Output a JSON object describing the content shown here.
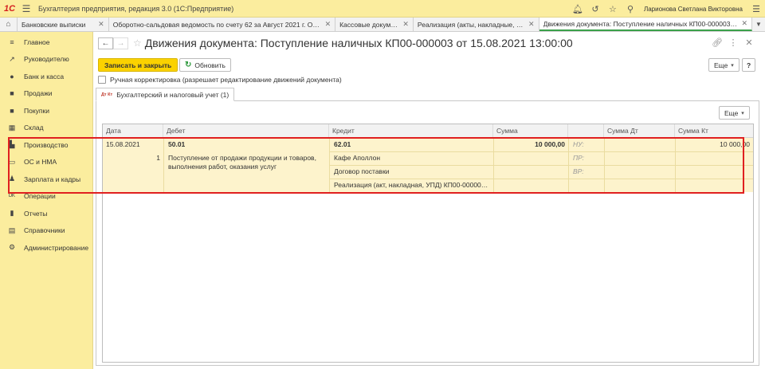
{
  "app": {
    "logo": "1С",
    "title": "Бухгалтерия предприятия, редакция 3.0  (1С:Предприятие)",
    "user": "Ларионова Светлана Викторовна"
  },
  "tabs": [
    {
      "label": "Банковские выписки"
    },
    {
      "label": "Оборотно-сальдовая ведомость по счету 62 за Август 2021 г. ООО \"..."
    },
    {
      "label": "Кассовые документы"
    },
    {
      "label": "Реализация (акты, накладные, УПД)"
    },
    {
      "label": "Движения документа: Поступление наличных КП00-000003 от 15.08...."
    }
  ],
  "sidebar": {
    "items": [
      {
        "label": "Главное",
        "icon": "≡"
      },
      {
        "label": "Руководителю",
        "icon": "↗"
      },
      {
        "label": "Банк и касса",
        "icon": "●"
      },
      {
        "label": "Продажи",
        "icon": "■"
      },
      {
        "label": "Покупки",
        "icon": "■"
      },
      {
        "label": "Склад",
        "icon": "▦"
      },
      {
        "label": "Производство",
        "icon": "▙"
      },
      {
        "label": "ОС и НМА",
        "icon": "▭"
      },
      {
        "label": "Зарплата и кадры",
        "icon": "♟"
      },
      {
        "label": "Операции",
        "icon": "ᴰᴷ"
      },
      {
        "label": "Отчеты",
        "icon": "▮"
      },
      {
        "label": "Справочники",
        "icon": "▤"
      },
      {
        "label": "Администрирование",
        "icon": "⚙"
      }
    ]
  },
  "document": {
    "title": "Движения документа: Поступление наличных КП00-000003 от 15.08.2021 13:00:00",
    "save_close": "Записать и закрыть",
    "refresh": "Обновить",
    "more": "Еще",
    "help": "?",
    "manual_correction": "Ручная корректировка (разрешает редактирование движений документа)",
    "tab": "Бухгалтерский и налоговый учет (1)",
    "tab_icon": "Дт Кт"
  },
  "table": {
    "headers": {
      "date": "Дата",
      "debit": "Дебет",
      "credit": "Кредит",
      "sum": "Сумма",
      "type": "",
      "sum_dt": "Сумма Дт",
      "sum_kt": "Сумма Кт"
    },
    "row": {
      "date": "15.08.2021",
      "num": "1",
      "debit_account": "50.01",
      "debit_text": "Поступление от продажи продукции и товаров, выполнения работ, оказания услуг",
      "credit_account": "62.01",
      "credit_sub1": "Кафе Аполлон",
      "credit_sub2": "Договор поставки",
      "credit_sub3": "Реализация (акт, накладная, УПД) КП00-000002 от...",
      "sum": "10 000,00",
      "nu": "НУ:",
      "pr": "ПР:",
      "vr": "ВР:",
      "sum_kt": "10 000,00"
    }
  }
}
